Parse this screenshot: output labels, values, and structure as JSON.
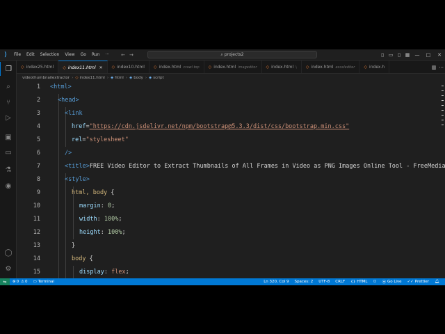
{
  "menu": [
    "File",
    "Edit",
    "Selection",
    "View",
    "Go",
    "Run",
    "···"
  ],
  "search": {
    "placeholder": "projects2",
    "icon": "search-icon"
  },
  "tabs": [
    {
      "name": "index25.html",
      "path": "",
      "active": false
    },
    {
      "name": "index11.html",
      "path": "",
      "active": true
    },
    {
      "name": "index10.html",
      "path": "",
      "active": false
    },
    {
      "name": "index.html",
      "path": "crawl.top",
      "active": false
    },
    {
      "name": "index.html",
      "path": "imageditor",
      "active": false
    },
    {
      "name": "index.html",
      "path": "\\",
      "active": false
    },
    {
      "name": "index.html",
      "path": "excelediter",
      "active": false
    },
    {
      "name": "index.h",
      "path": "",
      "active": false
    }
  ],
  "breadcrumb": [
    "videothumbnailextractor",
    "index11.html",
    "html",
    "body",
    "script"
  ],
  "code": {
    "line_numbers": [
      "1",
      "2",
      "3",
      "4",
      "5",
      "6",
      "7",
      "8",
      "9",
      "10",
      "11",
      "12",
      "13",
      "14",
      "15"
    ],
    "l1_tag": "<html>",
    "l2_tag": "<head>",
    "l3_tag": "<link",
    "l4_attr": "href",
    "l4_eq": "=",
    "l4_str": "\"https://cdn.jsdelivr.net/npm/bootstrap@5.3.3/dist/css/bootstrap.min.css\"",
    "l5_attr": "rel",
    "l5_eq": "=",
    "l5_str": "\"stylesheet\"",
    "l6_tag": "/>",
    "l7_open": "<title>",
    "l7_text": "FREE Video Editor to Extract Thumbnails of All Frames in Video as PNG Images Online Tool - FreeMediaTools.com",
    "l8_tag": "<style>",
    "l9_sel": "html, body",
    "l9_brace": " {",
    "l10_prop": "margin",
    "l10_colon": ": ",
    "l10_val": "0",
    "l10_semi": ";",
    "l11_prop": "width",
    "l11_colon": ": ",
    "l11_val": "100%",
    "l11_semi": ";",
    "l12_prop": "height",
    "l12_colon": ": ",
    "l12_val": "100%",
    "l12_semi": ";",
    "l13_brace": "}",
    "l14_sel": "body",
    "l14_brace": " {",
    "l15_prop": "display",
    "l15_colon": ": ",
    "l15_val": "flex",
    "l15_semi": ";"
  },
  "status": {
    "errors": "0",
    "warnings": "0",
    "terminal": "Terminal",
    "position": "Ln 320, Col 9",
    "spaces": "Spaces: 2",
    "encoding": "UTF-8",
    "eol": "CRLF",
    "language": "HTML",
    "golive": "Go Live",
    "prettier": "Prettier"
  },
  "colors": {
    "statusbar": "#0078d4",
    "tag": "#569cd6",
    "attr": "#9cdcfe",
    "string": "#ce9178"
  }
}
